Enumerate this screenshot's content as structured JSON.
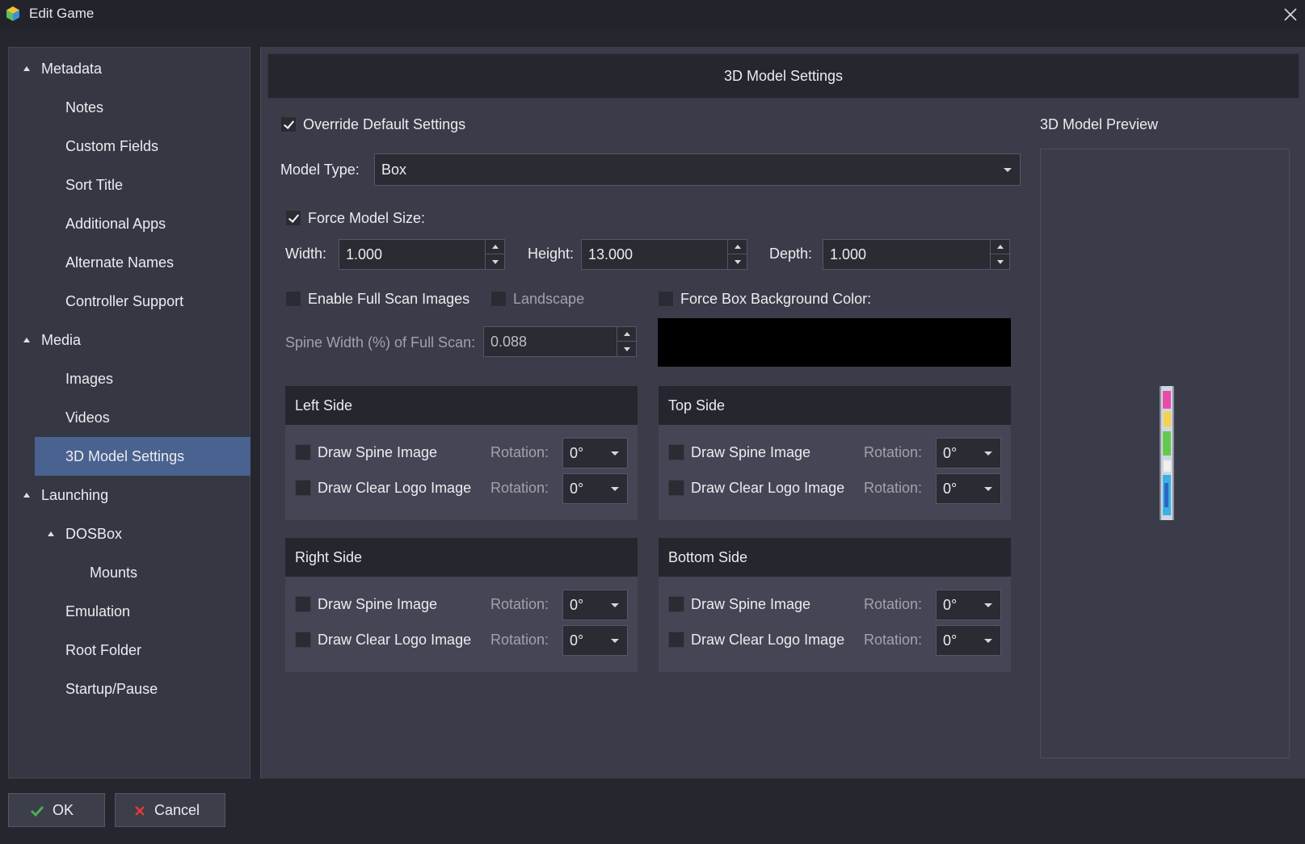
{
  "window": {
    "title": "Edit Game"
  },
  "sidebar": {
    "items": [
      {
        "label": "Metadata"
      },
      {
        "label": "Notes"
      },
      {
        "label": "Custom Fields"
      },
      {
        "label": "Sort Title"
      },
      {
        "label": "Additional Apps"
      },
      {
        "label": "Alternate Names"
      },
      {
        "label": "Controller Support"
      },
      {
        "label": "Media"
      },
      {
        "label": "Images"
      },
      {
        "label": "Videos"
      },
      {
        "label": "3D Model Settings"
      },
      {
        "label": "Launching"
      },
      {
        "label": "DOSBox"
      },
      {
        "label": "Mounts"
      },
      {
        "label": "Emulation"
      },
      {
        "label": "Root Folder"
      },
      {
        "label": "Startup/Pause"
      }
    ],
    "selected": "3D Model Settings"
  },
  "main": {
    "header": "3D Model Settings",
    "override_label": "Override Default Settings",
    "override_checked": true,
    "model_type_label": "Model Type:",
    "model_type_value": "Box",
    "force_size_label": "Force Model Size:",
    "force_size_checked": true,
    "width_label": "Width:",
    "width_value": "1.000",
    "height_label": "Height:",
    "height_value": "13.000",
    "depth_label": "Depth:",
    "depth_value": "1.000",
    "full_scan_label": "Enable Full Scan Images",
    "landscape_label": "Landscape",
    "force_bg_label": "Force Box Background Color:",
    "bg_color": "#000000",
    "spine_width_label": "Spine Width (%) of Full Scan:",
    "spine_width_value": "0.088",
    "groups": [
      {
        "title": "Left Side",
        "spine_label": "Draw Spine Image",
        "logo_label": "Draw Clear Logo Image",
        "rotation_label": "Rotation:",
        "spine_rotation": "0°",
        "logo_rotation": "0°"
      },
      {
        "title": "Top Side",
        "spine_label": "Draw Spine Image",
        "logo_label": "Draw Clear Logo Image",
        "rotation_label": "Rotation:",
        "spine_rotation": "0°",
        "logo_rotation": "0°"
      },
      {
        "title": "Right Side",
        "spine_label": "Draw Spine Image",
        "logo_label": "Draw Clear Logo Image",
        "rotation_label": "Rotation:",
        "spine_rotation": "0°",
        "logo_rotation": "0°"
      },
      {
        "title": "Bottom Side",
        "spine_label": "Draw Spine Image",
        "logo_label": "Draw Clear Logo Image",
        "rotation_label": "Rotation:",
        "spine_rotation": "0°",
        "logo_rotation": "0°"
      }
    ],
    "preview_title": "3D Model Preview"
  },
  "footer": {
    "ok_label": "OK",
    "cancel_label": "Cancel"
  },
  "colors": {
    "selected": "#4a628f",
    "panel": "#3a3c49",
    "ok_check": "#4caf50",
    "cancel_x": "#e53935"
  }
}
